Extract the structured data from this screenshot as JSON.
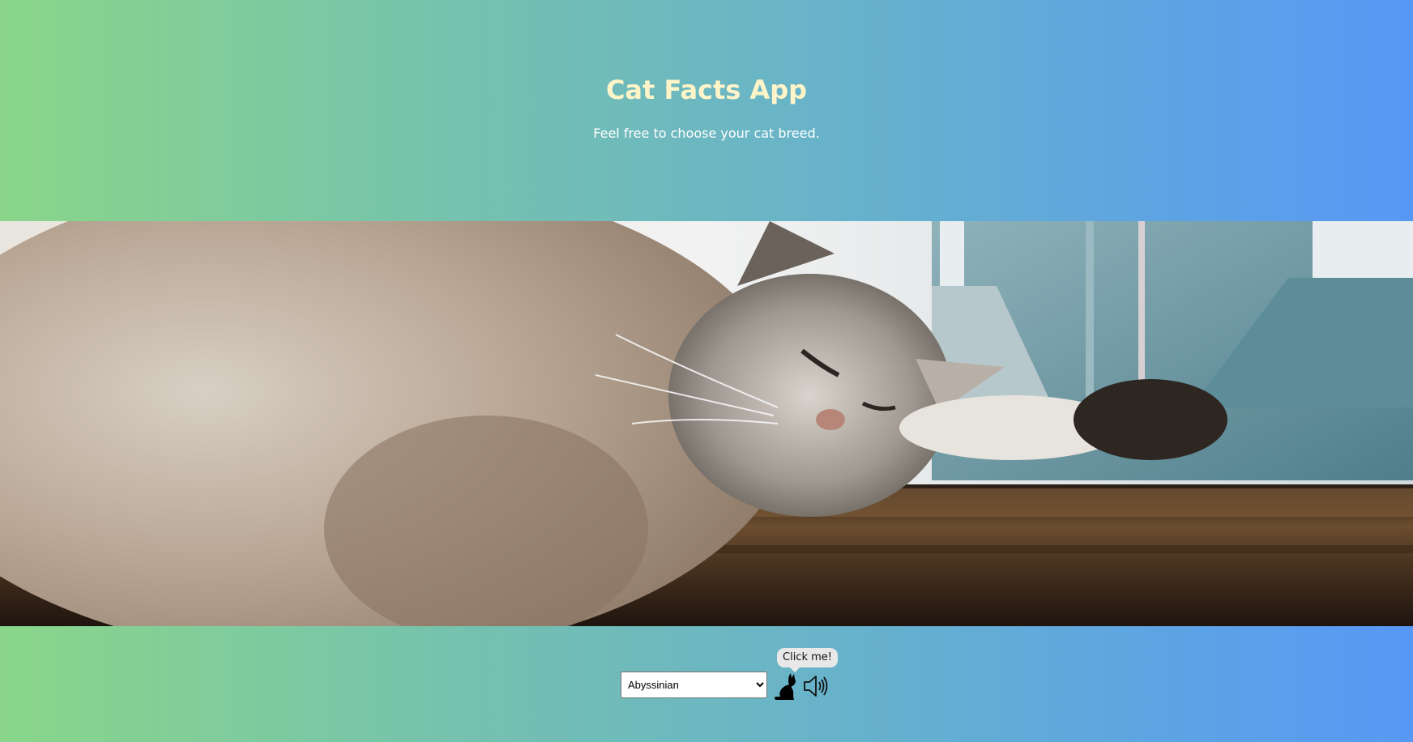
{
  "header": {
    "title": "Cat Facts App",
    "subtitle": "Feel free to choose your cat breed."
  },
  "hero": {
    "image_subject": "sleeping cat on a wooden window sill"
  },
  "controls": {
    "breed_select": {
      "selected": "Abyssinian",
      "options": [
        "Abyssinian"
      ]
    },
    "tooltip": "Click me!",
    "cat_icon": "cat-icon",
    "speaker_icon": "speaker-icon"
  },
  "colors": {
    "gradient_left": "#89d68a",
    "gradient_right": "#5798f6",
    "title_color": "#fff5c9"
  }
}
